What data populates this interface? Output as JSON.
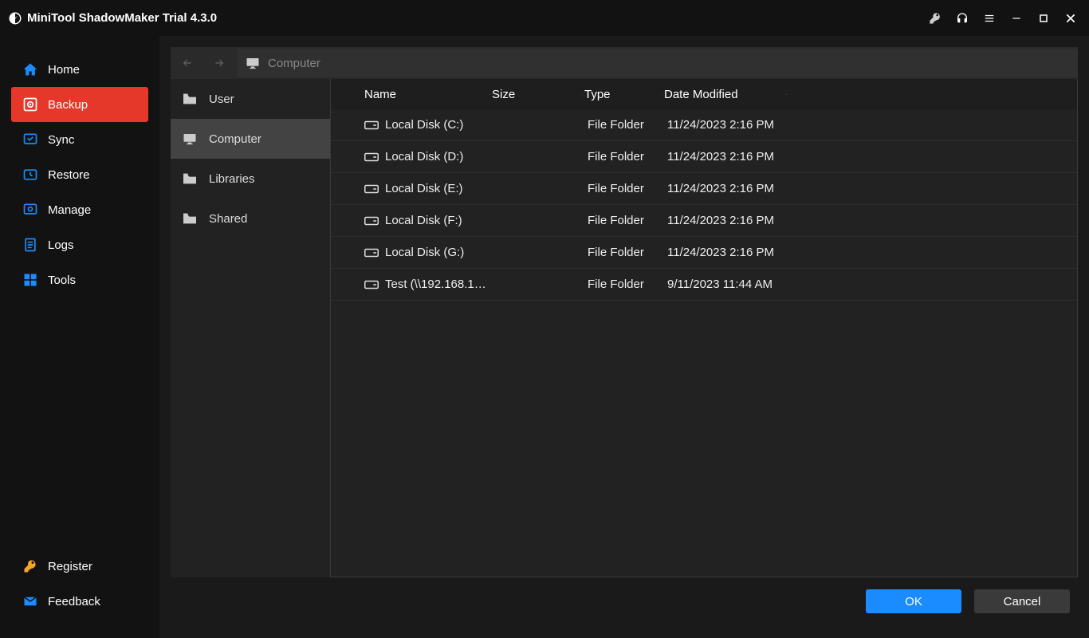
{
  "app": {
    "title": "MiniTool ShadowMaker Trial 4.3.0"
  },
  "sidebar": {
    "items": [
      {
        "label": "Home"
      },
      {
        "label": "Backup"
      },
      {
        "label": "Sync"
      },
      {
        "label": "Restore"
      },
      {
        "label": "Manage"
      },
      {
        "label": "Logs"
      },
      {
        "label": "Tools"
      }
    ],
    "bottom": [
      {
        "label": "Register"
      },
      {
        "label": "Feedback"
      }
    ]
  },
  "breadcrumb": {
    "label": "Computer"
  },
  "tree": {
    "items": [
      {
        "label": "User"
      },
      {
        "label": "Computer"
      },
      {
        "label": "Libraries"
      },
      {
        "label": "Shared"
      }
    ]
  },
  "table": {
    "headers": {
      "name": "Name",
      "size": "Size",
      "type": "Type",
      "date": "Date Modified"
    },
    "rows": [
      {
        "name": "Local Disk (C:)",
        "type": "File Folder",
        "date": "11/24/2023 2:16 PM"
      },
      {
        "name": "Local Disk (D:)",
        "type": "File Folder",
        "date": "11/24/2023 2:16 PM"
      },
      {
        "name": "Local Disk (E:)",
        "type": "File Folder",
        "date": "11/24/2023 2:16 PM"
      },
      {
        "name": "Local Disk (F:)",
        "type": "File Folder",
        "date": "11/24/2023 2:16 PM"
      },
      {
        "name": "Local Disk (G:)",
        "type": "File Folder",
        "date": "11/24/2023 2:16 PM"
      },
      {
        "name": "Test (\\\\192.168.1…",
        "type": "File Folder",
        "date": "9/11/2023 11:44 AM"
      }
    ]
  },
  "footer": {
    "ok": "OK",
    "cancel": "Cancel"
  }
}
